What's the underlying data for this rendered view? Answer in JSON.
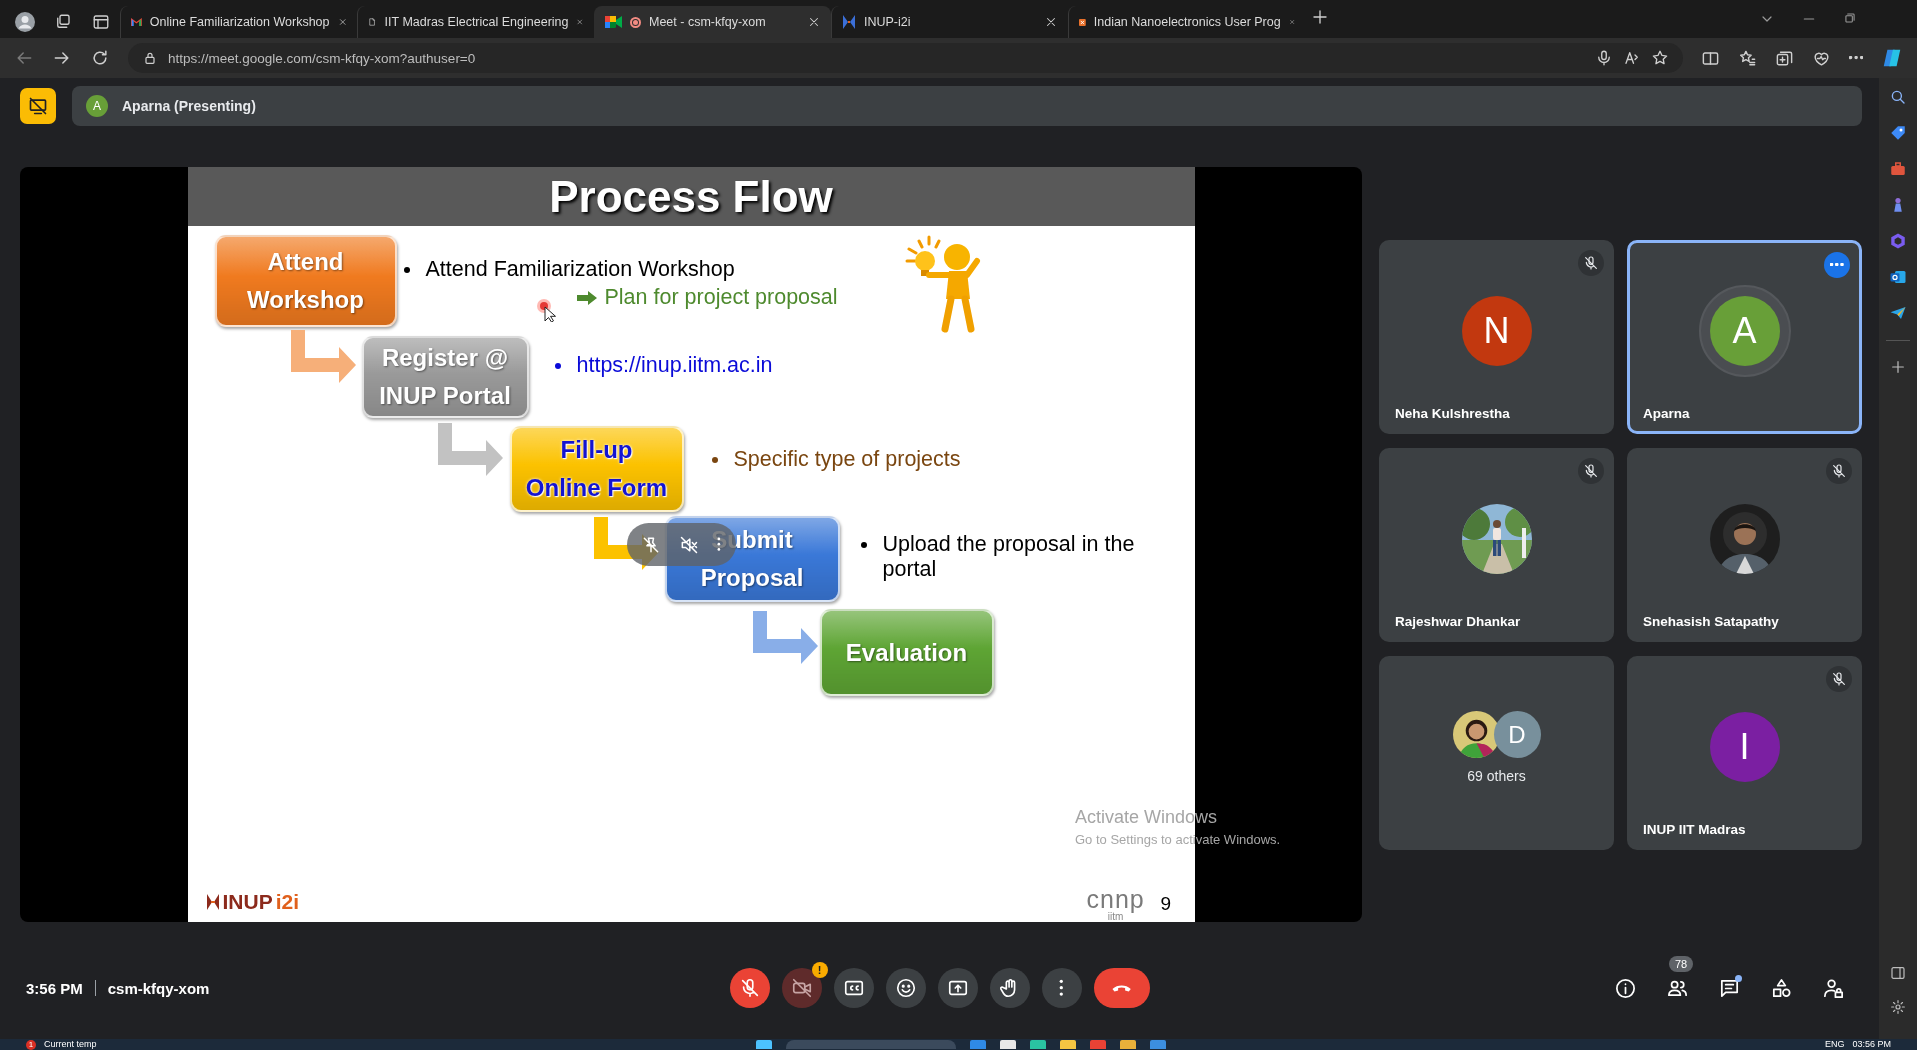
{
  "browser": {
    "tabs": [
      {
        "title": "Online Familiarization Workshop",
        "selected": false,
        "recording": false
      },
      {
        "title": "IIT Madras Electrical Engineering",
        "selected": false,
        "recording": false
      },
      {
        "title": "Meet - csm-kfqy-xom",
        "selected": true,
        "recording": true
      },
      {
        "title": "INUP-i2i",
        "selected": false,
        "recording": false
      },
      {
        "title": "Indian Nanoelectronics User Prog",
        "selected": false,
        "recording": false
      }
    ],
    "address": "https://meet.google.com/csm-kfqy-xom?authuser=0"
  },
  "meet": {
    "presenter": {
      "initial": "A",
      "label": "Aparna (Presenting)"
    },
    "slide": {
      "title": "Process Flow",
      "steps": [
        {
          "lines": [
            "Attend",
            "Workshop"
          ],
          "color": "#f07a1f"
        },
        {
          "lines": [
            "Register @",
            "INUP Portal"
          ],
          "color": "#9a9a9a"
        },
        {
          "lines": [
            "Fill-up",
            "Online Form"
          ],
          "color": "#fcc200"
        },
        {
          "lines": [
            "Submit",
            "Proposal"
          ],
          "color": "#3a78d8"
        },
        {
          "lines": [
            "Evaluation"
          ],
          "color": "#5ea534"
        }
      ],
      "notes": [
        {
          "kind": "bullet",
          "text": "Attend Familiarization Workshop",
          "color": "#000000"
        },
        {
          "kind": "arrow",
          "text": "Plan for project proposal",
          "color": "#4e8a2e"
        },
        {
          "kind": "bullet",
          "text": "https://inup.iitm.ac.in",
          "color": "#0b0bd8"
        },
        {
          "kind": "bullet",
          "text": "Specific type of projects",
          "color": "#7a4610"
        },
        {
          "kind": "bullet",
          "text": "Upload the proposal in the portal",
          "color": "#000000"
        }
      ],
      "logo": {
        "name": "INUP",
        "suffix": "i2i"
      },
      "partner_logo": {
        "name": "cnnp",
        "sub": "iitm"
      },
      "page_number": "9"
    },
    "activation_notice": {
      "title": "Activate Windows",
      "hint": "Go to Settings to activate Windows."
    },
    "participants": [
      {
        "kind": "person",
        "name": "Neha Kulshrestha",
        "avatar": {
          "kind": "letter",
          "letter": "N",
          "color": "#c2380f"
        },
        "muted": true,
        "highlighted": false
      },
      {
        "kind": "person",
        "name": "Aparna",
        "avatar": {
          "kind": "letter",
          "letter": "A",
          "color": "#689f38"
        },
        "muted": false,
        "highlighted": true
      },
      {
        "kind": "person",
        "name": "Rajeshwar Dhankar",
        "avatar": {
          "kind": "picture"
        },
        "muted": true,
        "highlighted": false
      },
      {
        "kind": "person",
        "name": "Snehasish Satapathy",
        "avatar": {
          "kind": "picture"
        },
        "muted": true,
        "highlighted": false
      },
      {
        "kind": "others",
        "label": "69 others",
        "avatars": [
          {
            "kind": "picture"
          },
          {
            "kind": "letter",
            "letter": "D",
            "color": "#78909c"
          }
        ],
        "muted": false,
        "highlighted": false
      },
      {
        "kind": "person",
        "name": "INUP IIT Madras",
        "avatar": {
          "kind": "letter",
          "letter": "I",
          "color": "#7b1fa2"
        },
        "muted": true,
        "highlighted": false
      }
    ],
    "footer": {
      "time": "3:56 PM",
      "meeting_code": "csm-kfqy-xom",
      "controls": [
        {
          "kind": "mic",
          "off": true
        },
        {
          "kind": "camera",
          "off": true,
          "alert": "!"
        },
        {
          "kind": "captions",
          "off": false
        },
        {
          "kind": "reactions",
          "off": false
        },
        {
          "kind": "present",
          "off": false
        },
        {
          "kind": "hand",
          "off": false
        },
        {
          "kind": "more",
          "off": false
        },
        {
          "kind": "leave"
        }
      ],
      "actions": [
        {
          "kind": "info"
        },
        {
          "kind": "people",
          "badge": "78"
        },
        {
          "kind": "chat",
          "unread": true
        },
        {
          "kind": "activities"
        },
        {
          "kind": "host"
        }
      ]
    }
  },
  "taskbar": {
    "notification_count": "1",
    "weather": "Current temp",
    "language": "ENG",
    "clock": "03:56 PM"
  }
}
